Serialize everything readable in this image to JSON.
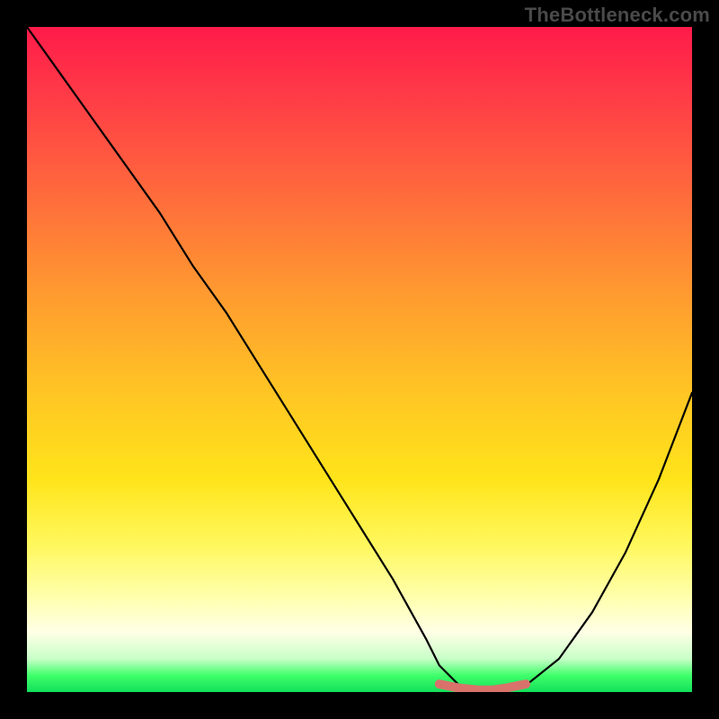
{
  "watermark": "TheBottleneck.com",
  "chart_data": {
    "type": "line",
    "title": "",
    "xlabel": "",
    "ylabel": "",
    "xlim": [
      0,
      100
    ],
    "ylim": [
      0,
      100
    ],
    "series": [
      {
        "name": "bottleneck-curve",
        "x": [
          0,
          5,
          10,
          15,
          20,
          25,
          30,
          35,
          40,
          45,
          50,
          55,
          60,
          62,
          65,
          68,
          70,
          72,
          75,
          80,
          85,
          90,
          95,
          100
        ],
        "values": [
          100,
          93,
          86,
          79,
          72,
          64,
          57,
          49,
          41,
          33,
          25,
          17,
          8,
          4,
          1,
          0,
          0,
          0,
          1,
          5,
          12,
          21,
          32,
          45
        ]
      },
      {
        "name": "optimal-range-marker",
        "x": [
          62,
          65,
          68,
          70,
          72,
          75
        ],
        "values": [
          1.2,
          0.6,
          0.3,
          0.3,
          0.6,
          1.2
        ]
      }
    ],
    "colors": {
      "curve": "#000000",
      "marker": "#d9726b",
      "gradient_top": "#ff1b4a",
      "gradient_mid": "#ffe41a",
      "gradient_bottom": "#12e05a"
    }
  }
}
